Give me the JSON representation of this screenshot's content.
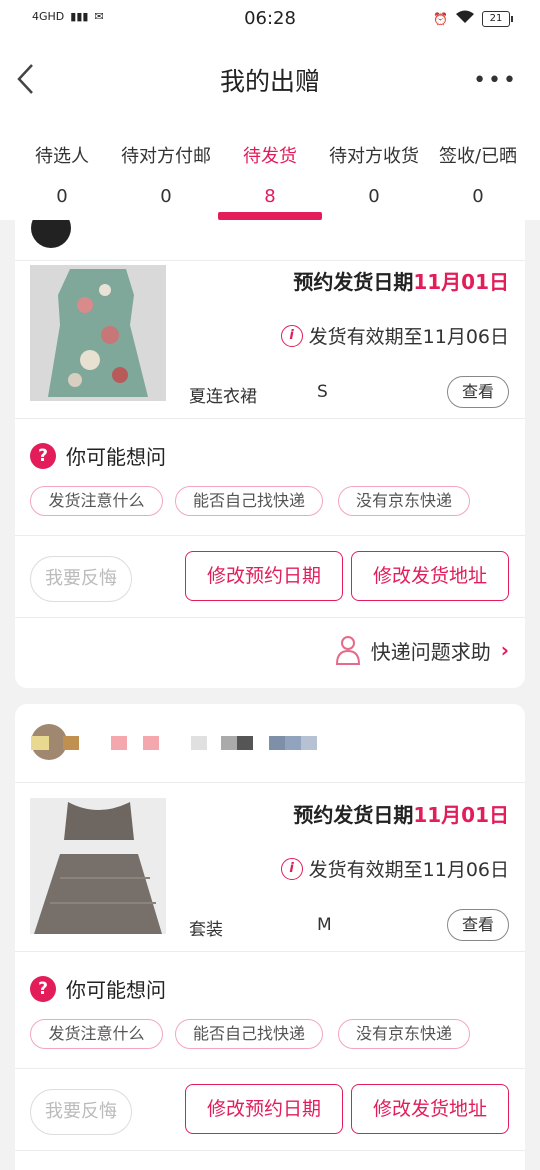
{
  "status_bar": {
    "network": "4GHD",
    "time": "06:28",
    "battery": "21"
  },
  "header": {
    "title": "我的出赠",
    "more": "•••"
  },
  "tabs": [
    {
      "label": "待选人",
      "count": "0"
    },
    {
      "label": "待对方付邮",
      "count": "0"
    },
    {
      "label": "待发货",
      "count": "8"
    },
    {
      "label": "待对方收货",
      "count": "0"
    },
    {
      "label": "签收/已晒",
      "count": "0"
    }
  ],
  "active_tab": 2,
  "orders": [
    {
      "ship_prefix": "预约发货日期",
      "ship_date": "11月01日",
      "valid_text": "发货有效期至11月06日",
      "item_name": "夏连衣裙",
      "item_size": "S",
      "view_label": "查看",
      "faq_title": "你可能想问",
      "faq_chips": [
        "发货注意什么",
        "能否自己找快递",
        "没有京东快递"
      ],
      "regret_label": "我要反悔",
      "change_date_label": "修改预约日期",
      "change_address_label": "修改发货地址",
      "help_label": "快递问题求助"
    },
    {
      "ship_prefix": "预约发货日期",
      "ship_date": "11月01日",
      "valid_text": "发货有效期至11月06日",
      "item_name": "套装",
      "item_size": "M",
      "view_label": "查看",
      "faq_title": "你可能想问",
      "faq_chips": [
        "发货注意什么",
        "能否自己找快递",
        "没有京东快递"
      ],
      "regret_label": "我要反悔",
      "change_date_label": "修改预约日期",
      "change_address_label": "修改发货地址"
    }
  ],
  "colors": {
    "accent": "#e31c5a",
    "background": "#f2f2f2"
  },
  "icons": [
    "back-arrow-icon",
    "more-icon",
    "info-icon",
    "question-icon",
    "user-support-icon",
    "chevron-right-icon"
  ]
}
